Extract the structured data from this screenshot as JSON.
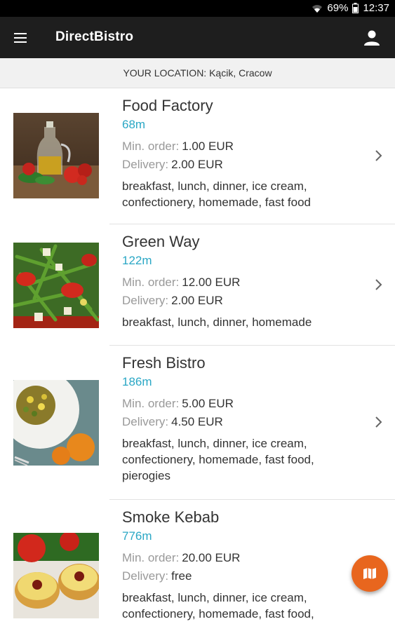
{
  "status": {
    "battery": "69%",
    "time": "12:37",
    "wifi_icon": "wifi-icon",
    "battery_icon": "battery-icon"
  },
  "app": {
    "title": "DirectBistro",
    "menu_icon": "menu-icon",
    "profile_icon": "account-icon"
  },
  "location": {
    "text": "YOUR LOCATION: Kącik, Cracow"
  },
  "labels": {
    "min_order": "Min. order:",
    "delivery": "Delivery:"
  },
  "restaurants": [
    {
      "name": "Food Factory",
      "distance": "68m",
      "min_order": "1.00 EUR",
      "delivery": "2.00 EUR",
      "tags": "breakfast, lunch, dinner, ice cream, confectionery, homemade, fast food",
      "image": "olive-oil-tomatoes-photo"
    },
    {
      "name": "Green Way",
      "distance": "122m",
      "min_order": "12.00 EUR",
      "delivery": "2.00 EUR",
      "tags": "breakfast, lunch, dinner, homemade",
      "image": "green-bean-salad-photo"
    },
    {
      "name": "Fresh Bistro",
      "distance": "186m",
      "min_order": "5.00 EUR",
      "delivery": "4.50 EUR",
      "tags": "breakfast, lunch, dinner, ice cream, confectionery, homemade, fast food, pierogies",
      "image": "salad-plate-oranges-photo"
    },
    {
      "name": "Smoke Kebab",
      "distance": "776m",
      "min_order": "20.00 EUR",
      "delivery": "free",
      "tags": "breakfast, lunch, dinner, ice cream, confectionery, homemade, fast food,",
      "image": "pineapple-toast-photo"
    }
  ],
  "fab": {
    "icon": "map-icon"
  },
  "colors": {
    "accent": "#2aa7c5",
    "fab": "#e8661e",
    "appbar": "#1e1e1e"
  }
}
